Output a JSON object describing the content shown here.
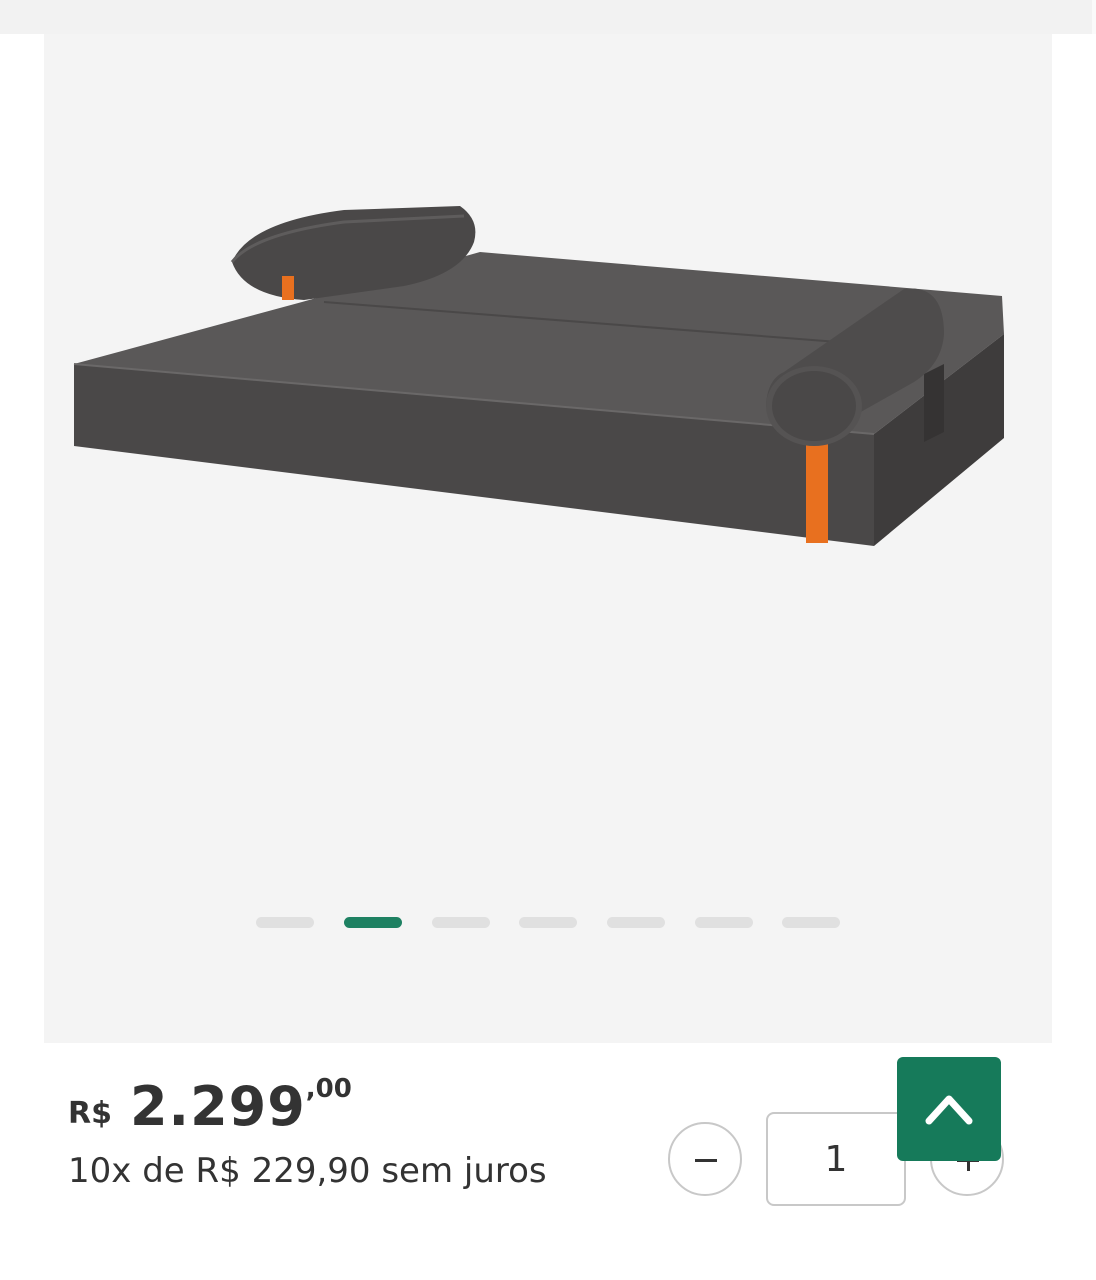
{
  "product": {
    "image_alt_icon": "sofa-bed-image",
    "gallery": {
      "slide_count": 7,
      "active_index": 1
    }
  },
  "price": {
    "currency": "R$",
    "amount": "2.299",
    "cents": ",00",
    "installments": "10x de R$ 229,90 sem juros"
  },
  "quantity": {
    "value": "1",
    "minus_icon": "minus-icon",
    "plus_icon": "plus-icon"
  },
  "scroll_top": {
    "icon": "chevron-up-icon"
  },
  "colors": {
    "accent": "#167a5a",
    "dot_active": "#1e8162",
    "dot_inactive": "#e0e0e0",
    "text": "#333333",
    "strap": "#e8701f"
  }
}
